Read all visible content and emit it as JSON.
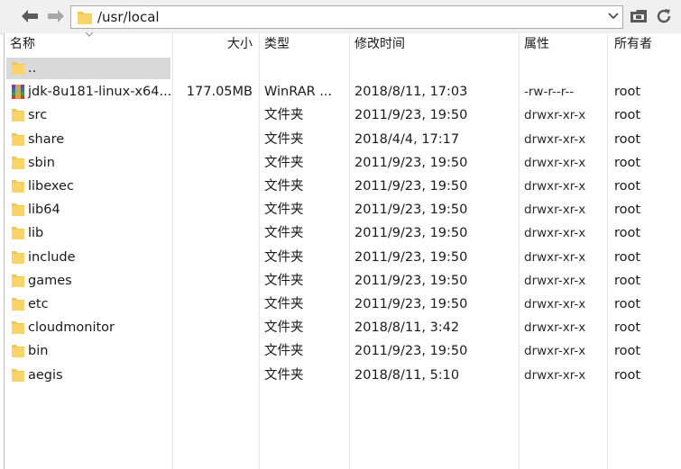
{
  "toolbar": {
    "path": "/usr/local"
  },
  "columns": {
    "name": "名称",
    "size": "大小",
    "type": "类型",
    "modified": "修改时间",
    "perms": "属性",
    "owner": "所有者"
  },
  "rows": [
    {
      "name": "..",
      "size": "",
      "type": "",
      "modified": "",
      "perms": "",
      "owner": "",
      "icon": "folder-icon"
    },
    {
      "name": "jdk-8u181-linux-x64...",
      "size": "177.05MB",
      "type": "WinRAR ...",
      "modified": "2018/8/11, 17:03",
      "perms": "-rw-r--r--",
      "owner": "root",
      "icon": "winrar-archive-icon"
    },
    {
      "name": "src",
      "size": "",
      "type": "文件夹",
      "modified": "2011/9/23, 19:50",
      "perms": "drwxr-xr-x",
      "owner": "root",
      "icon": "folder-icon"
    },
    {
      "name": "share",
      "size": "",
      "type": "文件夹",
      "modified": "2018/4/4, 17:17",
      "perms": "drwxr-xr-x",
      "owner": "root",
      "icon": "folder-icon"
    },
    {
      "name": "sbin",
      "size": "",
      "type": "文件夹",
      "modified": "2011/9/23, 19:50",
      "perms": "drwxr-xr-x",
      "owner": "root",
      "icon": "folder-icon"
    },
    {
      "name": "libexec",
      "size": "",
      "type": "文件夹",
      "modified": "2011/9/23, 19:50",
      "perms": "drwxr-xr-x",
      "owner": "root",
      "icon": "folder-icon"
    },
    {
      "name": "lib64",
      "size": "",
      "type": "文件夹",
      "modified": "2011/9/23, 19:50",
      "perms": "drwxr-xr-x",
      "owner": "root",
      "icon": "folder-icon"
    },
    {
      "name": "lib",
      "size": "",
      "type": "文件夹",
      "modified": "2011/9/23, 19:50",
      "perms": "drwxr-xr-x",
      "owner": "root",
      "icon": "folder-icon"
    },
    {
      "name": "include",
      "size": "",
      "type": "文件夹",
      "modified": "2011/9/23, 19:50",
      "perms": "drwxr-xr-x",
      "owner": "root",
      "icon": "folder-icon"
    },
    {
      "name": "games",
      "size": "",
      "type": "文件夹",
      "modified": "2011/9/23, 19:50",
      "perms": "drwxr-xr-x",
      "owner": "root",
      "icon": "folder-icon"
    },
    {
      "name": "etc",
      "size": "",
      "type": "文件夹",
      "modified": "2011/9/23, 19:50",
      "perms": "drwxr-xr-x",
      "owner": "root",
      "icon": "folder-icon"
    },
    {
      "name": "cloudmonitor",
      "size": "",
      "type": "文件夹",
      "modified": "2018/8/11, 3:42",
      "perms": "drwxr-xr-x",
      "owner": "root",
      "icon": "folder-icon"
    },
    {
      "name": "bin",
      "size": "",
      "type": "文件夹",
      "modified": "2011/9/23, 19:50",
      "perms": "drwxr-xr-x",
      "owner": "root",
      "icon": "folder-icon"
    },
    {
      "name": "aegis",
      "size": "",
      "type": "文件夹",
      "modified": "2018/8/11, 5:10",
      "perms": "drwxr-xr-x",
      "owner": "root",
      "icon": "folder-icon"
    }
  ],
  "colors": {
    "folder": "#f5c649",
    "selected": "#d9d9d9",
    "icon_gray": "#666666"
  }
}
